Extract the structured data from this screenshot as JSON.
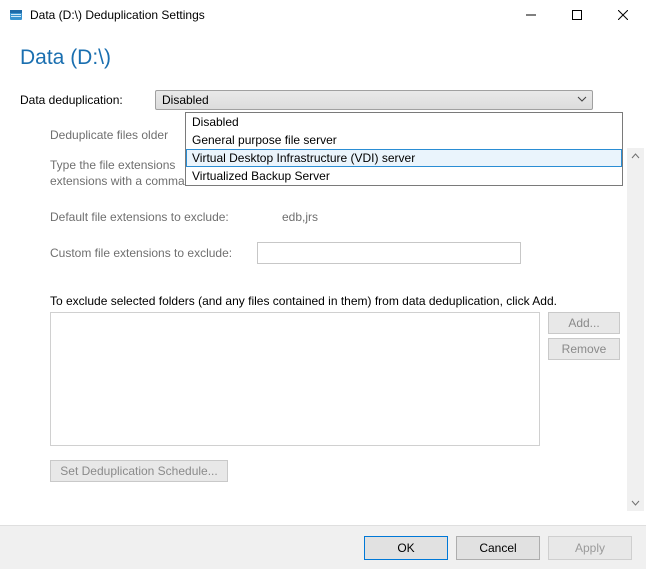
{
  "window": {
    "title": "Data (D:\\) Deduplication Settings"
  },
  "header": {
    "volume_title": "Data (D:\\)"
  },
  "main": {
    "dedup_label": "Data deduplication:",
    "combo_selected": "Disabled",
    "dropdown_options": [
      "Disabled",
      "General purpose file server",
      "Virtual Desktop Infrastructure (VDI) server",
      "Virtualized Backup Server"
    ],
    "dropdown_highlight_index": 2,
    "older_than_label": "Deduplicate files older",
    "type_ext_line1": "Type the file extensions",
    "type_ext_line2": "extensions with a comma",
    "default_ext_label": "Default file extensions to exclude:",
    "default_ext_value": "edb,jrs",
    "custom_ext_label": "Custom file extensions to exclude:",
    "custom_ext_value": "",
    "exclude_folders_text": "To exclude selected folders (and any files contained in them) from data deduplication, click Add.",
    "add_button": "Add...",
    "remove_button": "Remove",
    "schedule_button": "Set Deduplication Schedule..."
  },
  "buttons": {
    "ok": "OK",
    "cancel": "Cancel",
    "apply": "Apply"
  }
}
